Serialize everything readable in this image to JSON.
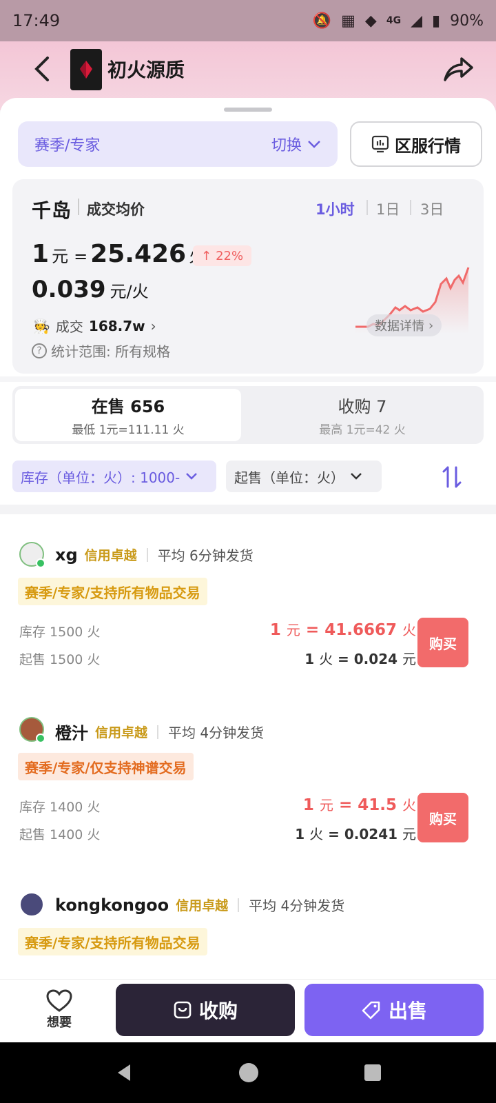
{
  "status": {
    "time": "17:49",
    "battery": "90%",
    "network": "4G"
  },
  "header": {
    "title": "初火源质"
  },
  "season": {
    "label": "赛季/专家",
    "switch_label": "切换",
    "region_label": "区服行情"
  },
  "price_card": {
    "logo": "千岛",
    "avg_label": "成交均价",
    "timeframes": [
      "1小时",
      "1日",
      "3日"
    ],
    "active_timeframe": "1小时",
    "rate_prefix": "1",
    "rate_unit_yuan": "元",
    "rate_eq": "=",
    "rate_value": "25.426",
    "rate_unit_fire": "火",
    "change": "22%",
    "unit_price": "0.039",
    "unit_price_suffix": "元/火",
    "volume_label": "成交",
    "volume_value": "168.7w",
    "scope": "统计范围: 所有规格",
    "detail_label": "数据详情",
    "trend_color": "#f06a6a"
  },
  "tabs": [
    {
      "label": "在售 656",
      "sub": "最低 1元=111.11 火"
    },
    {
      "label": "收购 7",
      "sub": "最高 1元=42 火"
    }
  ],
  "filters": {
    "stock": "库存（单位：火）: 1000-",
    "min_sale": "起售（单位：火）"
  },
  "listings": [
    {
      "name": "xg",
      "credit": "信用卓越",
      "ship": "平均 6分钟发货",
      "tag": "赛季/专家/支持所有物品交易",
      "stock": "库存 1500 火",
      "min": "起售 1500 火",
      "rate_l": "1",
      "rate_r": "41.6667",
      "unit_l": "1",
      "unit_r": "0.024",
      "buy": "购买"
    },
    {
      "name": "橙汁",
      "credit": "信用卓越",
      "ship": "平均 4分钟发货",
      "tag": "赛季/专家/仅支持神谱交易",
      "stock": "库存 1400 火",
      "min": "起售 1400 火",
      "rate_l": "1",
      "rate_r": "41.5",
      "unit_l": "1",
      "unit_r": "0.0241",
      "buy": "购买"
    },
    {
      "name": "kongkongoo",
      "credit": "信用卓越",
      "ship": "平均 4分钟发货",
      "tag": "赛季/专家/支持所有物品交易"
    }
  ],
  "bottom": {
    "want": "想要",
    "collect": "收购",
    "sell": "出售"
  },
  "colors": {
    "accent": "#7d63f2",
    "buy": "#f26b6b",
    "price": "#ef5a5a",
    "credit": "#c99a1a"
  }
}
